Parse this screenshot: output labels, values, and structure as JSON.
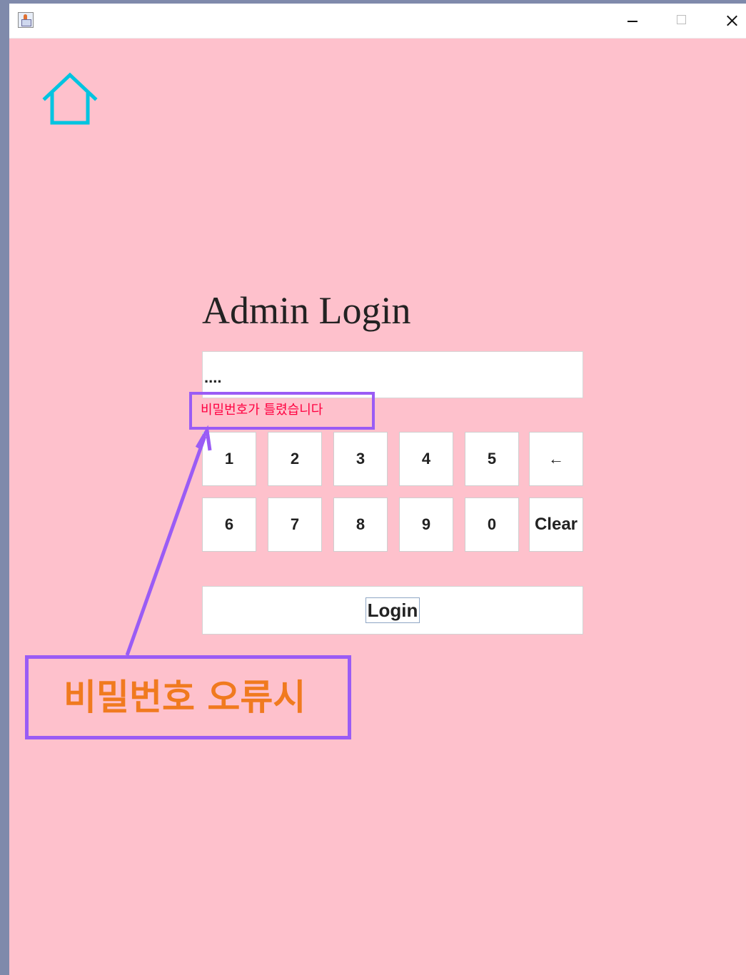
{
  "window": {
    "controls": {
      "minimize_icon": "minimize-icon",
      "maximize_icon": "maximize-icon",
      "close_icon": "close-icon"
    },
    "app_icon": "java-app-icon"
  },
  "home": {
    "icon": "house-icon",
    "color": "#00c4e0"
  },
  "login": {
    "title": "Admin Login",
    "password_value": "....",
    "error_message": "비밀번호가 틀렸습니다",
    "button_label": "Login"
  },
  "keypad": {
    "rows": [
      [
        "1",
        "2",
        "3",
        "4",
        "5",
        "←"
      ],
      [
        "6",
        "7",
        "8",
        "9",
        "0",
        "Clear"
      ]
    ]
  },
  "annotation": {
    "callout_text": "비밀번호 오류시",
    "border_color": "#9a5cf5",
    "text_color": "#f07a1f"
  },
  "colors": {
    "background": "#fec1cc",
    "error": "#ff0040"
  }
}
